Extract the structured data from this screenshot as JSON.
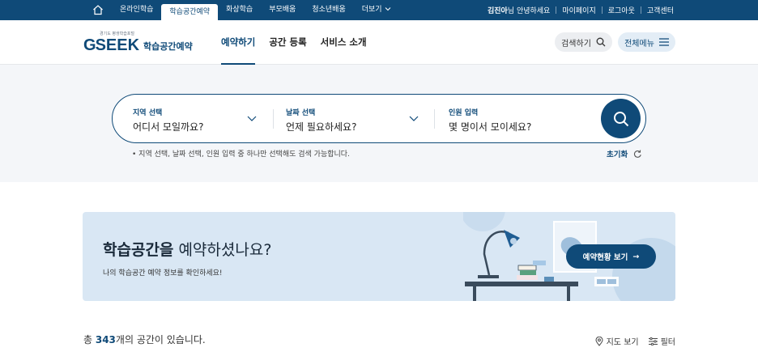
{
  "topbar": {
    "nav": [
      {
        "label": "온라인학습"
      },
      {
        "label": "학습공간예약",
        "active": true
      },
      {
        "label": "화상학습"
      },
      {
        "label": "부모배움"
      },
      {
        "label": "청소년배움"
      },
      {
        "label": "더보기"
      }
    ],
    "user_name": "김진아",
    "greeting": "님 안녕하세요",
    "mypage": "마이페이지",
    "logout": "로그아웃",
    "support": "고객센터"
  },
  "header": {
    "logo_small": "경기도 평생학습포털",
    "logo_g": "G",
    "logo_seek": "SEEK",
    "service_name": "학습공간예약",
    "nav": [
      {
        "label": "예약하기",
        "active": true
      },
      {
        "label": "공간 등록"
      },
      {
        "label": "서비스 소개"
      }
    ],
    "search_label": "검색하기",
    "menu_label": "전체메뉴"
  },
  "search": {
    "region_label": "지역 선택",
    "region_value": "어디서 모일까요?",
    "date_label": "날짜 선택",
    "date_value": "언제 필요하세요?",
    "people_label": "인원 입력",
    "people_value": "몇 명이서 모이세요?",
    "note": "• 지역 선택, 날짜 선택, 인원 입력 중 하나만 선택해도 검색 가능합니다.",
    "reset_label": "초기화"
  },
  "banner": {
    "title_bold": "학습공간을",
    "title_rest": " 예약하셨나요?",
    "subtitle": "나의 학습공간 예약 정보를 확인하세요!",
    "button_label": "예약현황 보기",
    "button_arrow": "→"
  },
  "results": {
    "prefix": "총 ",
    "count": "343",
    "suffix": "개의 공간이 있습니다.",
    "map_label": "지도 보기",
    "filter_label": "필터"
  },
  "colors": {
    "brand": "#0f4a78",
    "banner_bg": "#d9e7f4",
    "hero_bg": "#f4f6f9"
  }
}
